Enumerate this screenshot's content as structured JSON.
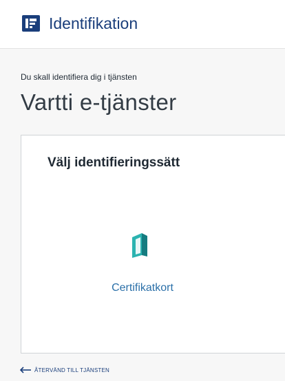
{
  "header": {
    "logo_icon": "suomi-fi-logo-icon",
    "title": "Identifikation",
    "brand_color": "#1a3e7b"
  },
  "intro": {
    "text": "Du skall identifiera dig i tjänsten",
    "service_name": "Vartti e-tjänster"
  },
  "card": {
    "title": "Välj identifieringssätt",
    "methods": [
      {
        "icon": "certificate-card-icon",
        "label": "Certifikatkort",
        "icon_color": "#1a9a9a"
      }
    ]
  },
  "footer": {
    "back_icon": "left-arrow-icon",
    "back_label": "Återvänd till tjänsten"
  }
}
